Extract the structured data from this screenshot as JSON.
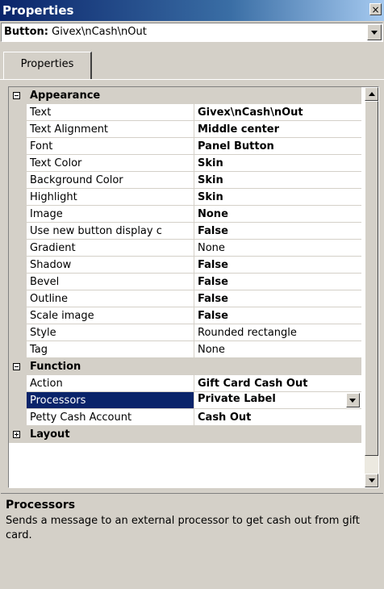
{
  "window": {
    "title": "Properties",
    "close_glyph": "×"
  },
  "object_selector": {
    "type_label": "Button:",
    "name": "Givex\\nCash\\nOut"
  },
  "tabs": [
    {
      "label": "Properties"
    }
  ],
  "grid": {
    "categories": [
      {
        "name": "Appearance",
        "expanded": true,
        "properties": [
          {
            "name": "Text",
            "value": "Givex\\nCash\\nOut",
            "bold": true
          },
          {
            "name": "Text Alignment",
            "value": "Middle center",
            "bold": true
          },
          {
            "name": "Font",
            "value": "Panel Button",
            "bold": true
          },
          {
            "name": "Text Color",
            "value": "Skin",
            "bold": true
          },
          {
            "name": "Background Color",
            "value": "Skin",
            "bold": true
          },
          {
            "name": "Highlight",
            "value": "Skin",
            "bold": true
          },
          {
            "name": "Image",
            "value": "None",
            "bold": true
          },
          {
            "name": "Use new button display c",
            "value": "False",
            "bold": true
          },
          {
            "name": "Gradient",
            "value": "None",
            "bold": false
          },
          {
            "name": "Shadow",
            "value": "False",
            "bold": true
          },
          {
            "name": "Bevel",
            "value": "False",
            "bold": true
          },
          {
            "name": "Outline",
            "value": "False",
            "bold": true
          },
          {
            "name": "Scale image",
            "value": "False",
            "bold": true
          },
          {
            "name": "Style",
            "value": "Rounded rectangle",
            "bold": false
          },
          {
            "name": "Tag",
            "value": "None",
            "bold": false
          }
        ]
      },
      {
        "name": "Function",
        "expanded": true,
        "properties": [
          {
            "name": "Action",
            "value": "Gift Card Cash Out",
            "bold": true
          },
          {
            "name": "Processors",
            "value": "Private Label",
            "bold": true,
            "selected": true
          },
          {
            "name": "Petty Cash Account",
            "value": "Cash Out",
            "bold": true
          }
        ]
      },
      {
        "name": "Layout",
        "expanded": false,
        "properties": []
      }
    ]
  },
  "description": {
    "title": "Processors",
    "text": "Sends a message to an external processor to get cash out from gift card."
  },
  "colors": {
    "selection": "#0a246a",
    "panel": "#d4d0c8"
  }
}
